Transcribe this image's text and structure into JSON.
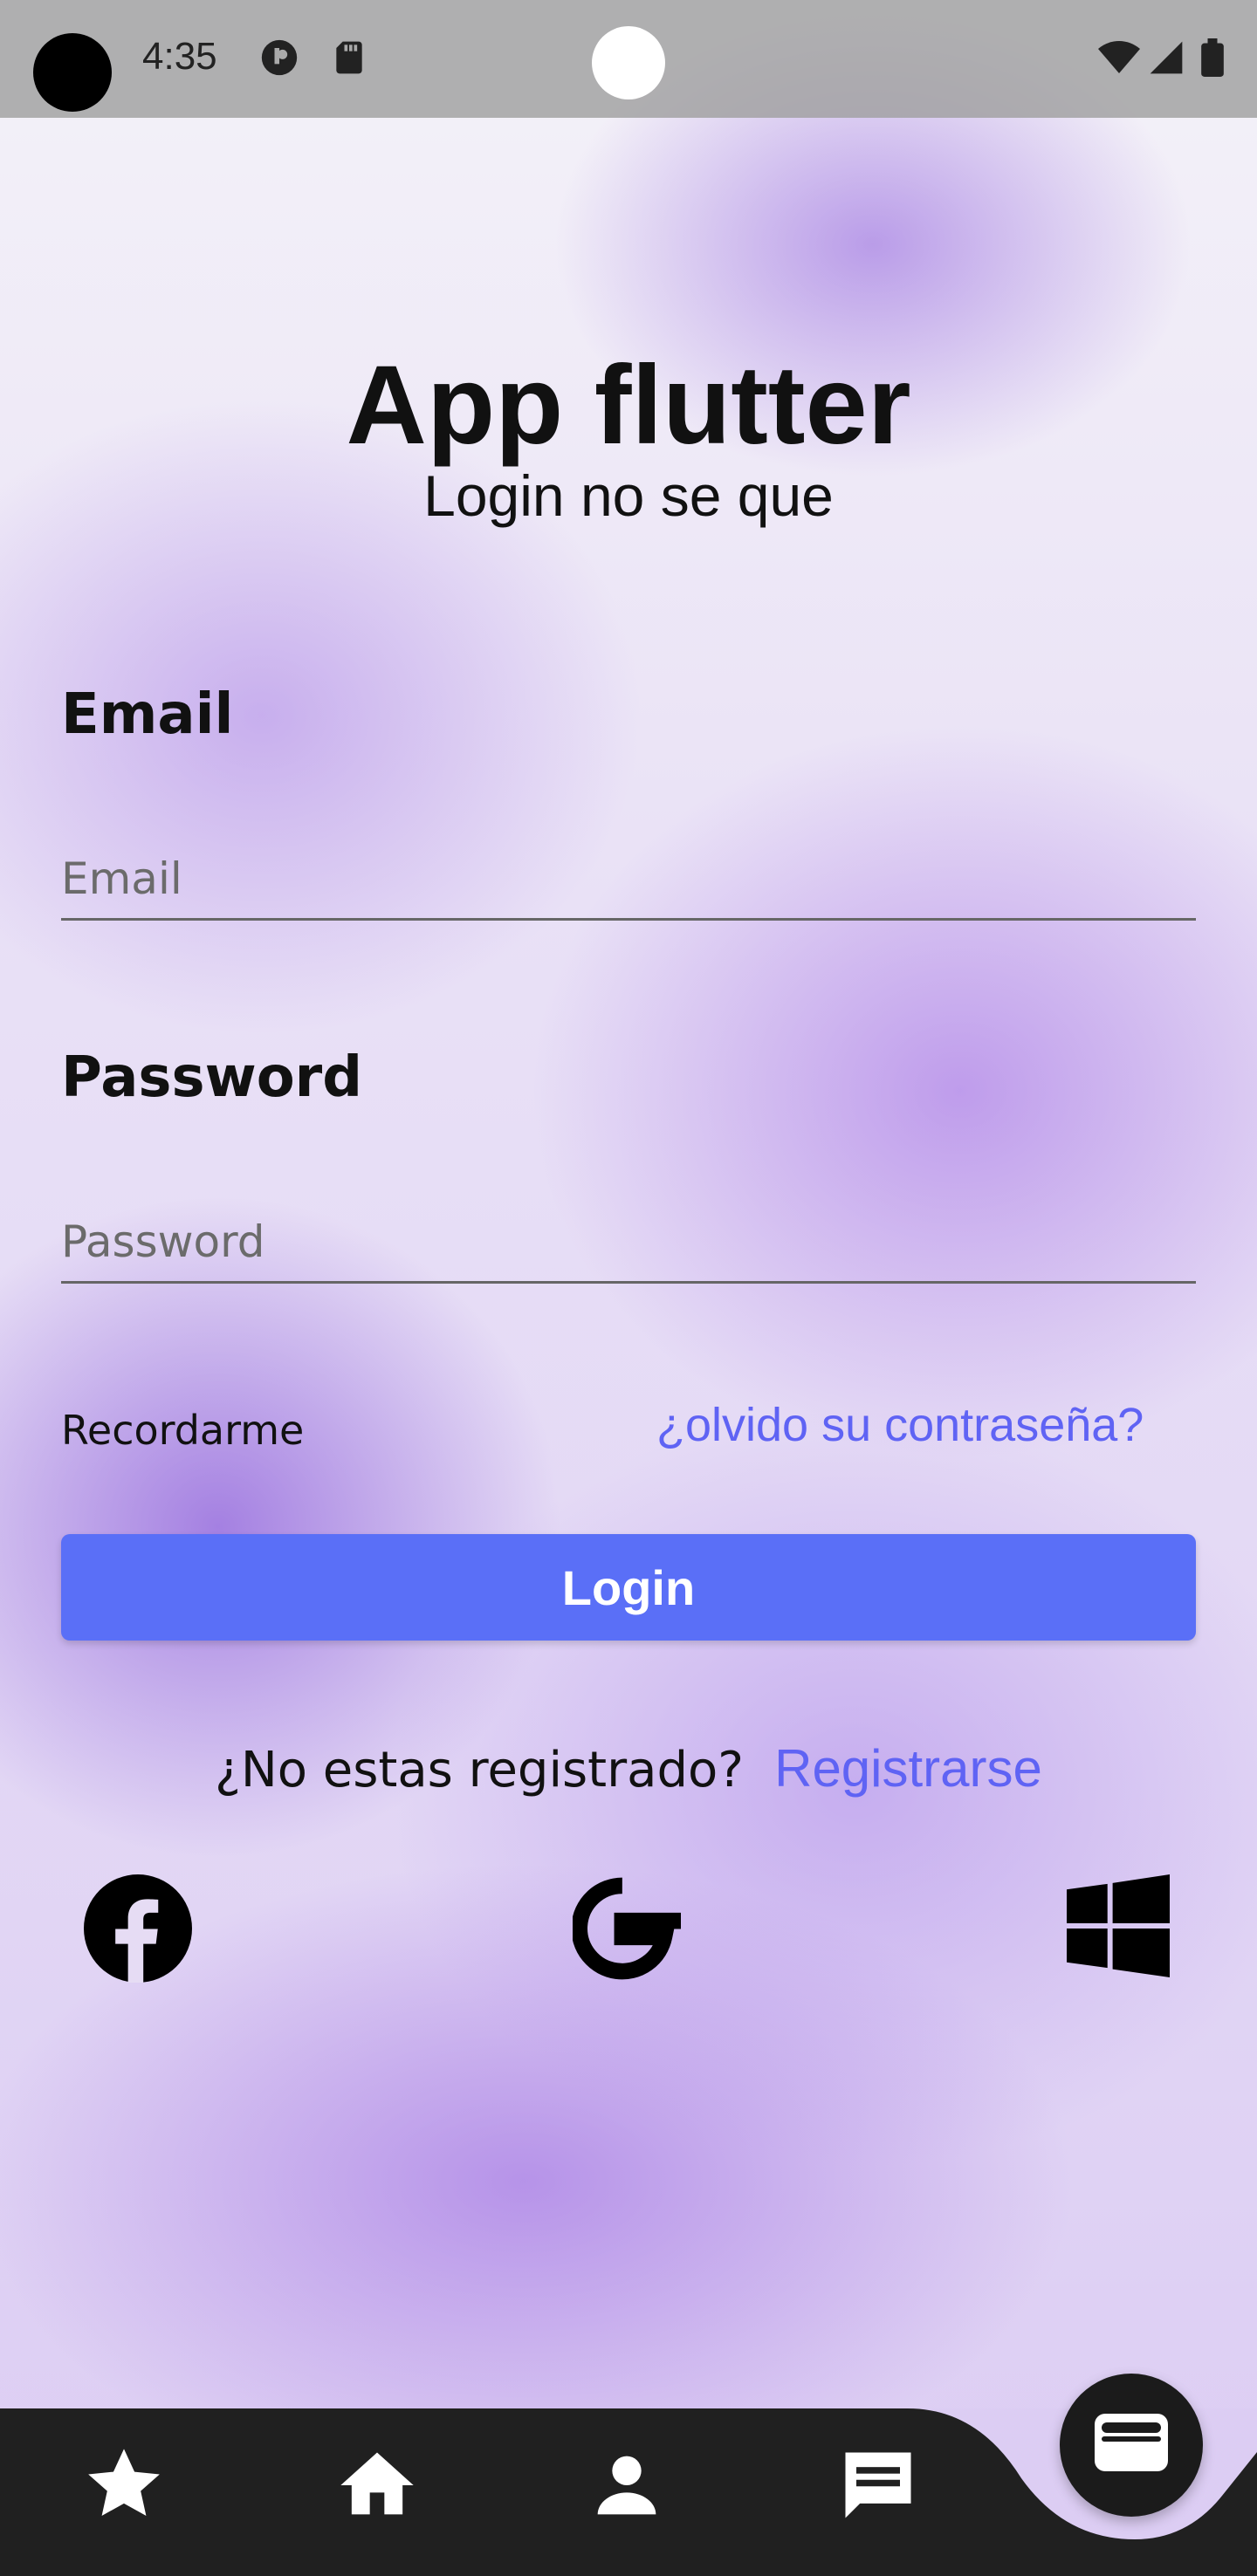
{
  "status_bar": {
    "time": "4:35"
  },
  "header": {
    "title": "App flutter",
    "subtitle": "Login no se que"
  },
  "form": {
    "email_label": "Email",
    "email_placeholder": "Email",
    "password_label": "Password",
    "password_placeholder": "Password",
    "remember_label": "Recordarme",
    "forgot_link": "¿olvido su contraseña?",
    "login_button": "Login"
  },
  "register": {
    "question": "¿No estas registrado?",
    "link": "Registrarse"
  },
  "social": {
    "icons": [
      "facebook-icon",
      "google-icon",
      "windows-icon"
    ]
  },
  "bottom_nav": {
    "items": [
      "star-icon",
      "home-icon",
      "person-icon",
      "chat-icon"
    ]
  },
  "fab": {
    "icon": "wallet-icon"
  },
  "colors": {
    "accent": "#5a6ff7",
    "link": "#5f63f4",
    "nav_bg": "#202020"
  }
}
